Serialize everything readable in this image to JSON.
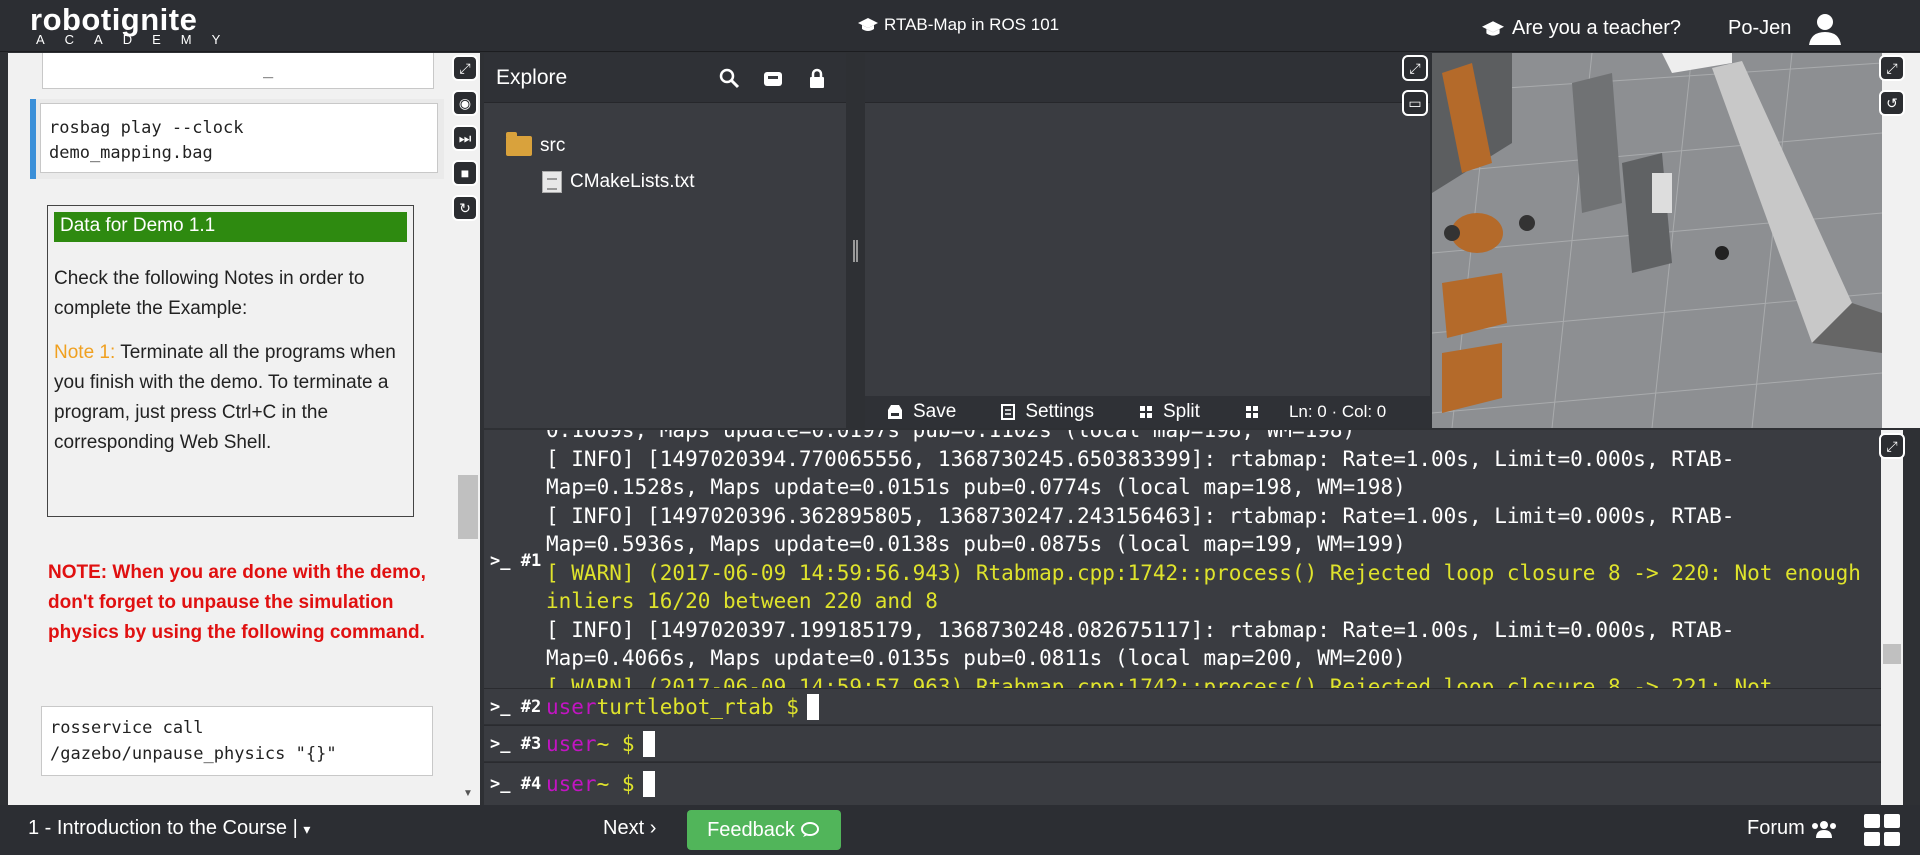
{
  "header": {
    "logo_top": "robotignite",
    "logo_bottom": "ACADEMY",
    "course_title": "RTAB-Map in ROS 101",
    "teacher_link": "Are you a teacher?",
    "username": "Po-Jen"
  },
  "notebook": {
    "code_top_fragment": "_",
    "code_rosbag": "rosbag play --clock\ndemo_mapping.bag",
    "demo_header": "Data for Demo 1.1",
    "demo_intro": "Check the following Notes in order to complete the Example:",
    "note1_label": "Note 1:",
    "note1_text": " Terminate all the programs when you finish with the demo. To terminate a program, just press Ctrl+C in the corresponding Web Shell.",
    "note_red": "NOTE: When you are done with the demo, don't forget to unpause the simulation physics by using the following command.",
    "code_rosservice": "rosservice call\n/gazebo/unpause_physics \"{}\""
  },
  "explorer": {
    "title": "Explore",
    "tree": [
      {
        "name": "src",
        "type": "folder"
      },
      {
        "name": "CMakeLists.txt",
        "type": "file"
      }
    ]
  },
  "editor": {
    "save_label": "Save",
    "settings_label": "Settings",
    "split_label": "Split",
    "position": "Ln: 0 · Col: 0"
  },
  "terminal": {
    "label_1": ">_ #1",
    "lines": [
      {
        "type": "info",
        "text": "0.1669s, Maps update=0.0197s pub=0.1102s (local map=198, WM=198)"
      },
      {
        "type": "info",
        "text": "[ INFO] [1497020394.770065556, 1368730245.650383399]: rtabmap: Rate=1.00s, Limit=0.000s, RTAB-Map=0.1528s, Maps update=0.0151s pub=0.0774s (local map=198, WM=198)"
      },
      {
        "type": "info",
        "text": "[ INFO] [1497020396.362895805, 1368730247.243156463]: rtabmap: Rate=1.00s, Limit=0.000s, RTAB-Map=0.5936s, Maps update=0.0138s pub=0.0875s (local map=199, WM=199)"
      },
      {
        "type": "warn",
        "text": "[ WARN] (2017-06-09 14:59:56.943) Rtabmap.cpp:1742::process() Rejected loop closure 8 -> 220: Not enough inliers 16/20 between 220 and 8"
      },
      {
        "type": "info",
        "text": "[ INFO] [1497020397.199185179, 1368730248.082675117]: rtabmap: Rate=1.00s, Limit=0.000s, RTAB-Map=0.4066s, Maps update=0.0135s pub=0.0811s (local map=200, WM=200)"
      },
      {
        "type": "warn",
        "text": "[ WARN] (2017-06-09 14:59:57.963) Rtabmap.cpp:1742::process() Rejected loop closure 8 -> 221: Not"
      }
    ],
    "shells": [
      {
        "label": ">_ #2",
        "user": "user",
        "path": " turtlebot_rtab $"
      },
      {
        "label": ">_ #3",
        "user": "user",
        "path": " ~ $"
      },
      {
        "label": ">_ #4",
        "user": "user",
        "path": " ~ $"
      }
    ]
  },
  "footer": {
    "chapter": "1 - Introduction to the Course |",
    "next": "Next",
    "feedback": "Feedback",
    "forum": "Forum"
  },
  "colors": {
    "accent_green": "#51b55a",
    "demo_header_green": "#2e8a10",
    "warn_yellow": "#dfe32c",
    "shell_user_magenta": "#c214c2",
    "note_red": "#e01010",
    "note_orange": "#f0a020"
  }
}
